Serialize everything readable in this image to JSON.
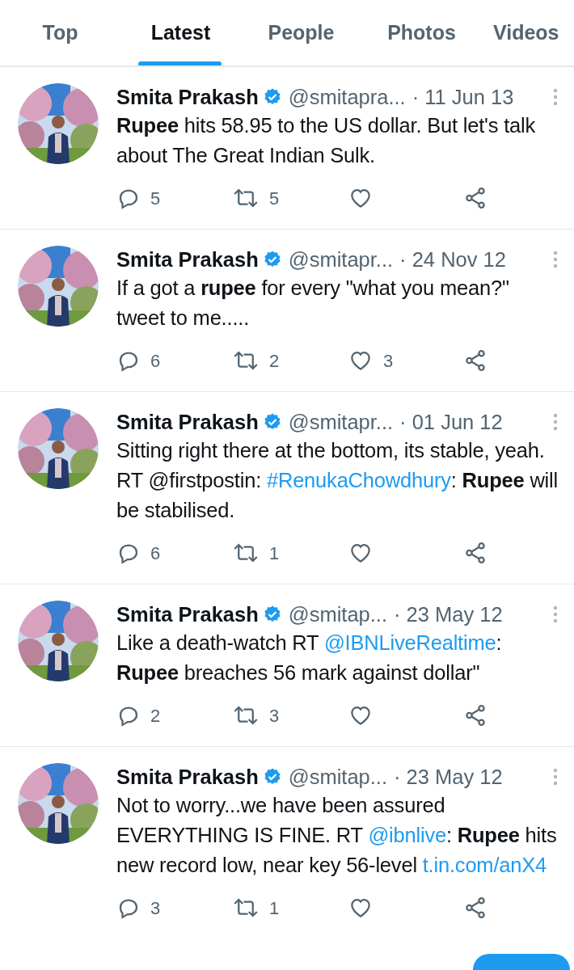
{
  "tabs": [
    {
      "label": "Top",
      "selected": false
    },
    {
      "label": "Latest",
      "selected": true
    },
    {
      "label": "People",
      "selected": false
    },
    {
      "label": "Photos",
      "selected": false
    },
    {
      "label": "Videos",
      "selected": false
    }
  ],
  "tweets": [
    {
      "name": "Smita Prakash",
      "verified": true,
      "handle": "@smitapra...",
      "date": "· 11 Jun 13",
      "avatar": {
        "kind": "picture"
      },
      "text": [
        {
          "kind": "text",
          "text": "**Rupee** hits 58.95 to the US dollar. But let's talk about The Great Indian Sulk."
        }
      ],
      "replies": "5",
      "retweets": "5"
    },
    {
      "name": "Smita Prakash",
      "verified": true,
      "handle": "@smitapr...",
      "date": "· 24 Nov 12",
      "avatar": {
        "kind": "picture"
      },
      "text": [
        {
          "kind": "text",
          "text": "If a got a **rupee** for every \"what you mean?\" tweet to me....."
        }
      ],
      "replies": "6",
      "retweets": "2",
      "likes": "3"
    },
    {
      "name": "Smita Prakash",
      "verified": true,
      "handle": "@smitapr...",
      "date": "· 01 Jun 12",
      "avatar": {
        "kind": "picture"
      },
      "text": [
        {
          "kind": "text",
          "text": "Sitting right there at the bottom, its stable, yeah. RT @firstpostin: "
        },
        {
          "kind": "link",
          "text": "#RenukaChowdhury"
        },
        {
          "kind": "text",
          "text": ": **Rupee** will be stabilised."
        }
      ],
      "replies": "6",
      "retweets": "1"
    },
    {
      "name": "Smita Prakash",
      "verified": true,
      "handle": "@smitap...",
      "date": "· 23 May 12",
      "avatar": {
        "kind": "picture"
      },
      "text": [
        {
          "kind": "text",
          "text": "Like a death-watch RT "
        },
        {
          "kind": "link",
          "text": "@IBNLiveRealtime"
        },
        {
          "kind": "text",
          "text": ": **Rupee** breaches 56 mark against dollar\""
        }
      ],
      "replies": "2",
      "retweets": "3"
    },
    {
      "name": "Smita Prakash",
      "verified": true,
      "handle": "@smitap...",
      "date": "· 23 May 12",
      "avatar": {
        "kind": "picture"
      },
      "text": [
        {
          "kind": "text",
          "text": "Not to worry...we have been assured EVERYTHING IS FINE. RT "
        },
        {
          "kind": "link",
          "text": "@ibnlive"
        },
        {
          "kind": "text",
          "text": ": **Rupee** hits new record low, near key 56-level "
        },
        {
          "kind": "link",
          "text": "t.in.com/anX4"
        }
      ],
      "replies": "3",
      "retweets": "1"
    }
  ]
}
